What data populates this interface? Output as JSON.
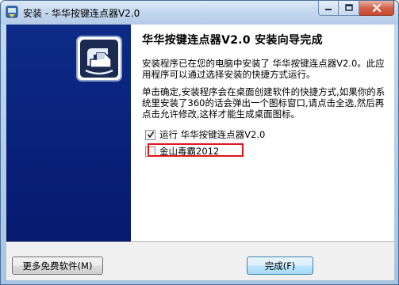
{
  "window": {
    "title": "安装 - 华华按键连点器V2.0",
    "icon": "installer-icon",
    "controls": [
      "minimize-icon",
      "maximize-icon",
      "close-icon"
    ]
  },
  "wizard": {
    "heading": "华华按键连点器V2.0 安装向导完成",
    "paragraph1": "安装程序已在您的电脑中安装了 华华按键连点器V2.0。此应用程序可以通过选择安装的快捷方式运行。",
    "paragraph2": "单击确定,安装程序会在桌面创建软件的快捷方式,如果你的系统里安装了360的话会弹出一个图标窗口,请点击全选,然后再点击允许修改,这样才能生成桌面图标。",
    "options": [
      {
        "label": "运行 华华按键连点器V2.0",
        "checked": true
      },
      {
        "label": "金山毒霸2012",
        "checked": false
      }
    ]
  },
  "footer": {
    "more_button": "更多免费软件(M)",
    "finish_button": "完成(F)"
  },
  "colors": {
    "sidebar": "#0b2580",
    "highlight": "#e0141a"
  }
}
